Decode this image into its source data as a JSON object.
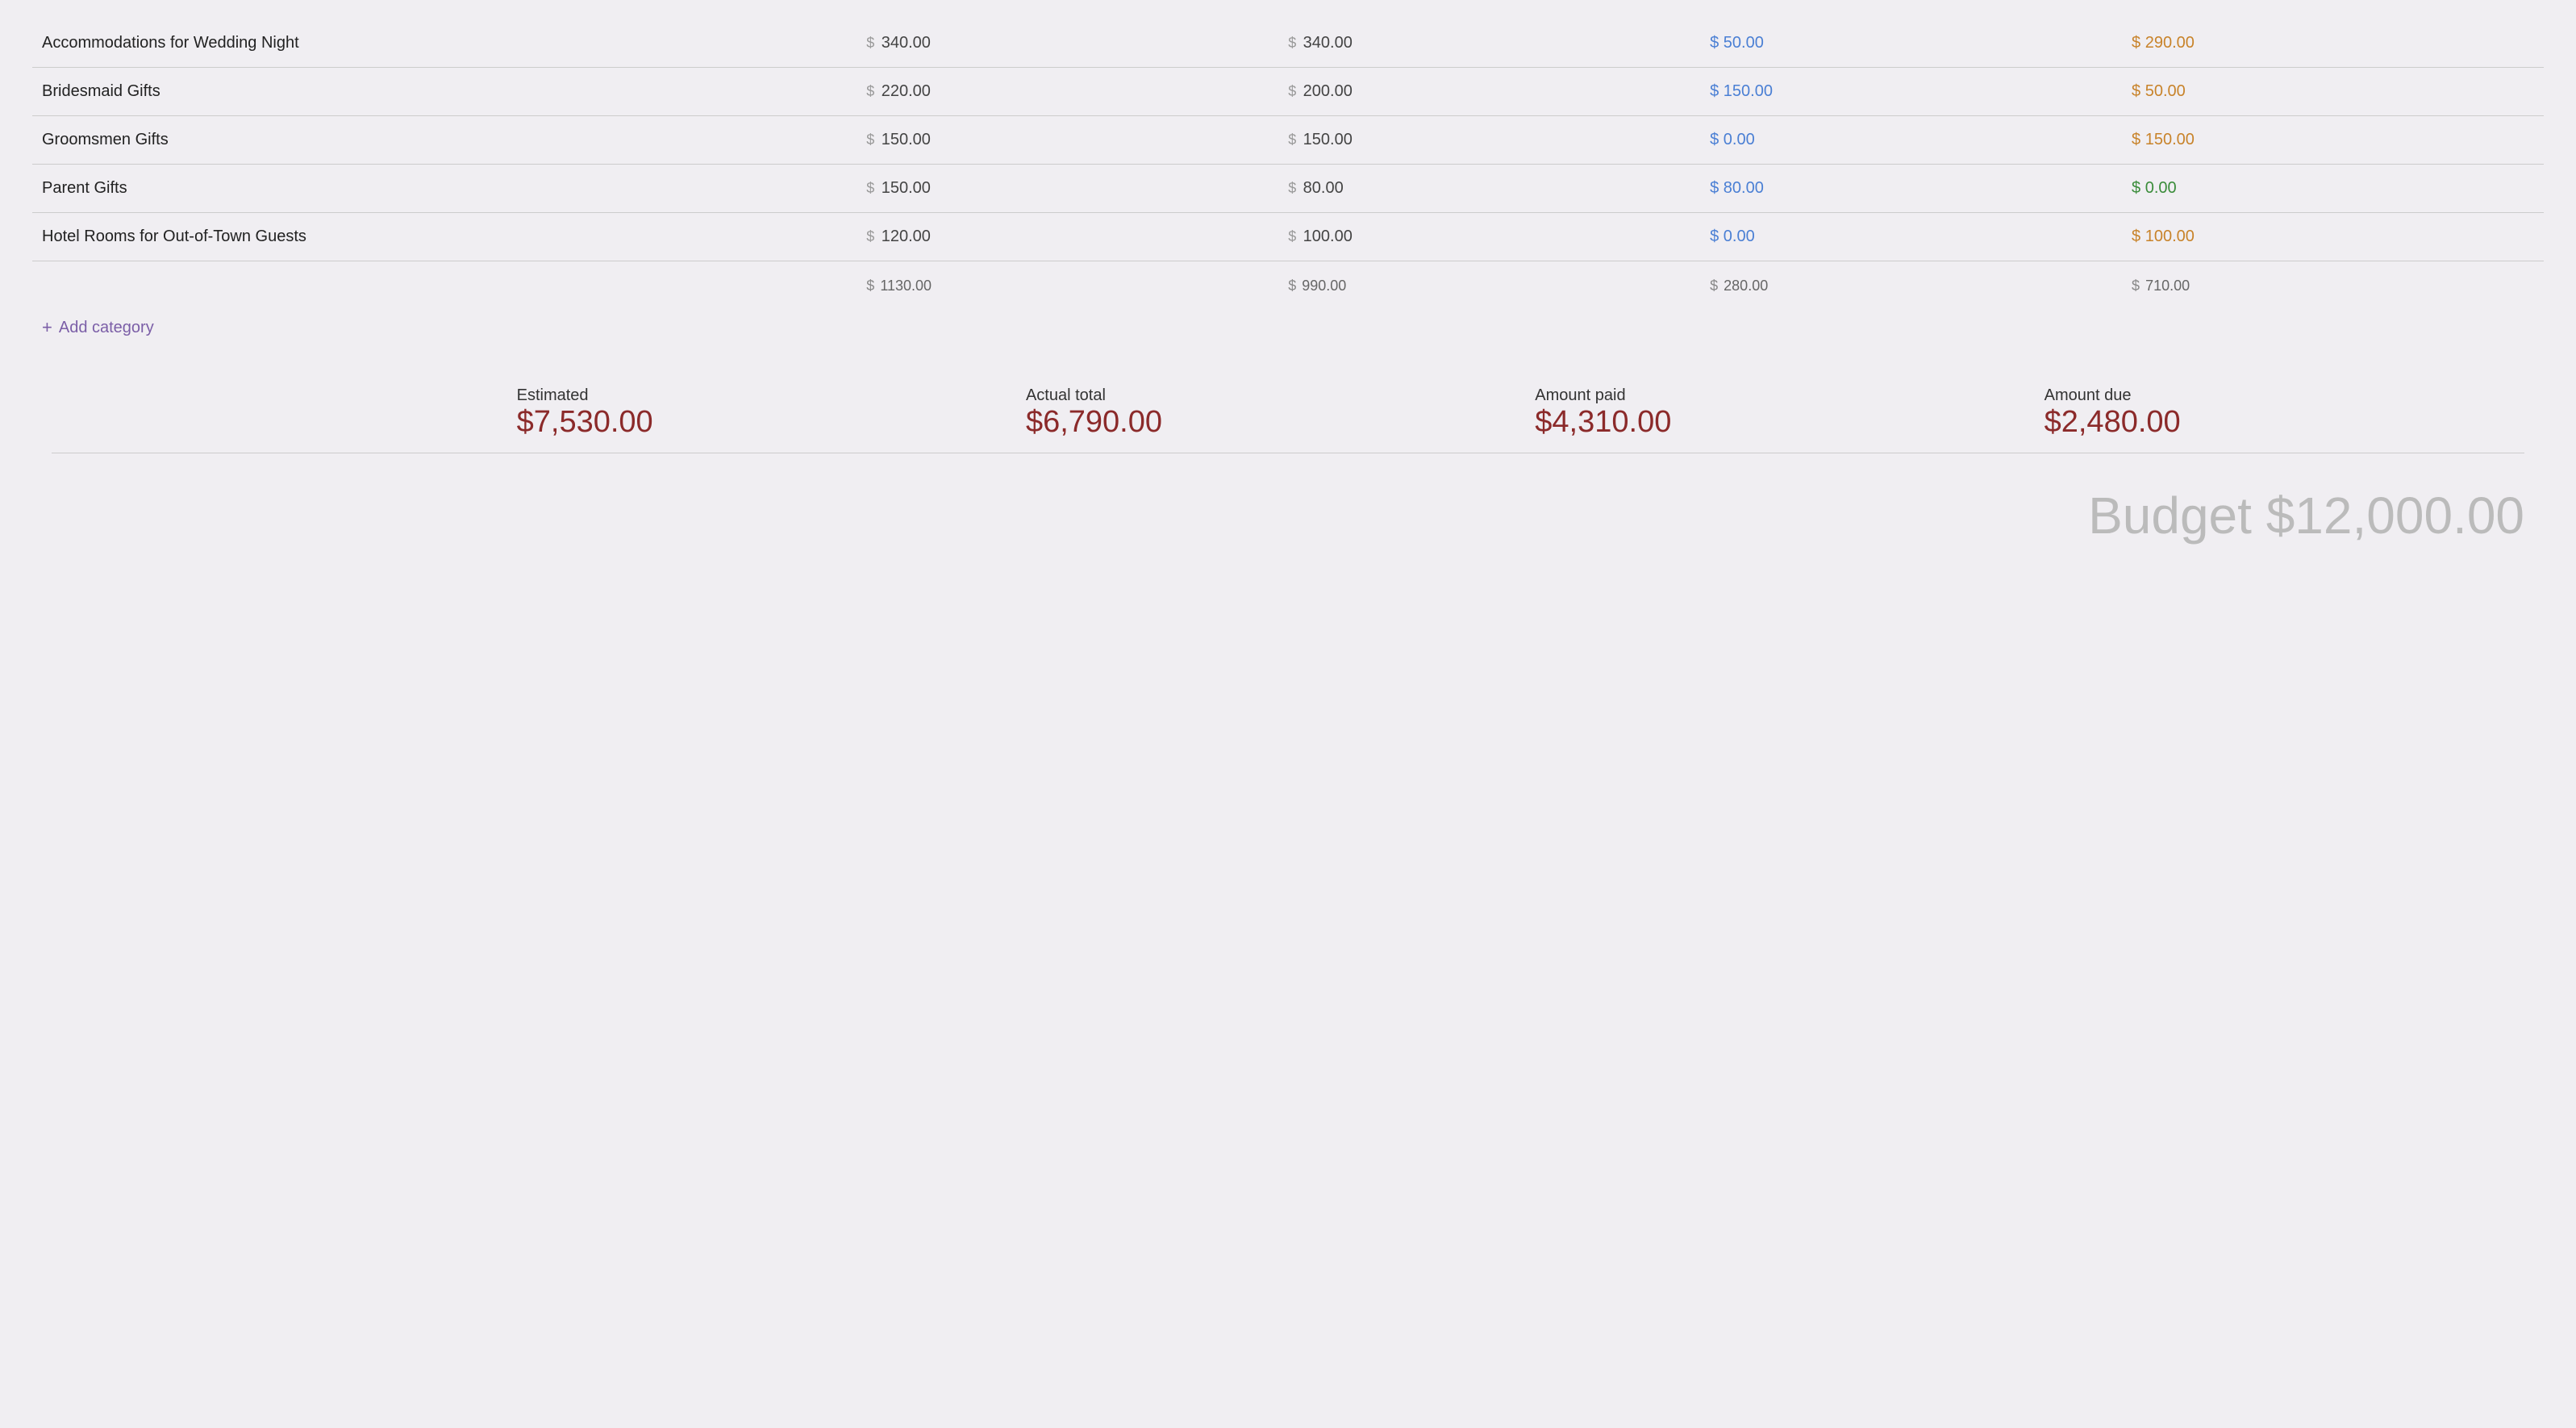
{
  "rows": [
    {
      "name": "Accommodations for Wedding Night",
      "estimated": "340.00",
      "actual": "340.00",
      "paid": "50.00",
      "due": "290.00",
      "due_color": "orange"
    },
    {
      "name": "Bridesmaid Gifts",
      "estimated": "220.00",
      "actual": "200.00",
      "paid": "150.00",
      "due": "50.00",
      "due_color": "orange"
    },
    {
      "name": "Groomsmen Gifts",
      "estimated": "150.00",
      "actual": "150.00",
      "paid": "0.00",
      "due": "150.00",
      "due_color": "orange"
    },
    {
      "name": "Parent Gifts",
      "estimated": "150.00",
      "actual": "80.00",
      "paid": "80.00",
      "due": "0.00",
      "due_color": "green"
    },
    {
      "name": "Hotel Rooms for Out-of-Town Guests",
      "estimated": "120.00",
      "actual": "100.00",
      "paid": "0.00",
      "due": "100.00",
      "due_color": "orange"
    }
  ],
  "totals": {
    "estimated": "1130.00",
    "actual": "990.00",
    "paid": "280.00",
    "due": "710.00"
  },
  "add_category_label": "Add category",
  "summary": {
    "estimated_label": "Estimated",
    "actual_label": "Actual total",
    "paid_label": "Amount paid",
    "due_label": "Amount due",
    "estimated_value": "$7,530.00",
    "actual_value": "$6,790.00",
    "paid_value": "$4,310.00",
    "due_value": "$2,480.00"
  },
  "budget_label": "Budget $12,000.00",
  "currency_symbol": "$"
}
